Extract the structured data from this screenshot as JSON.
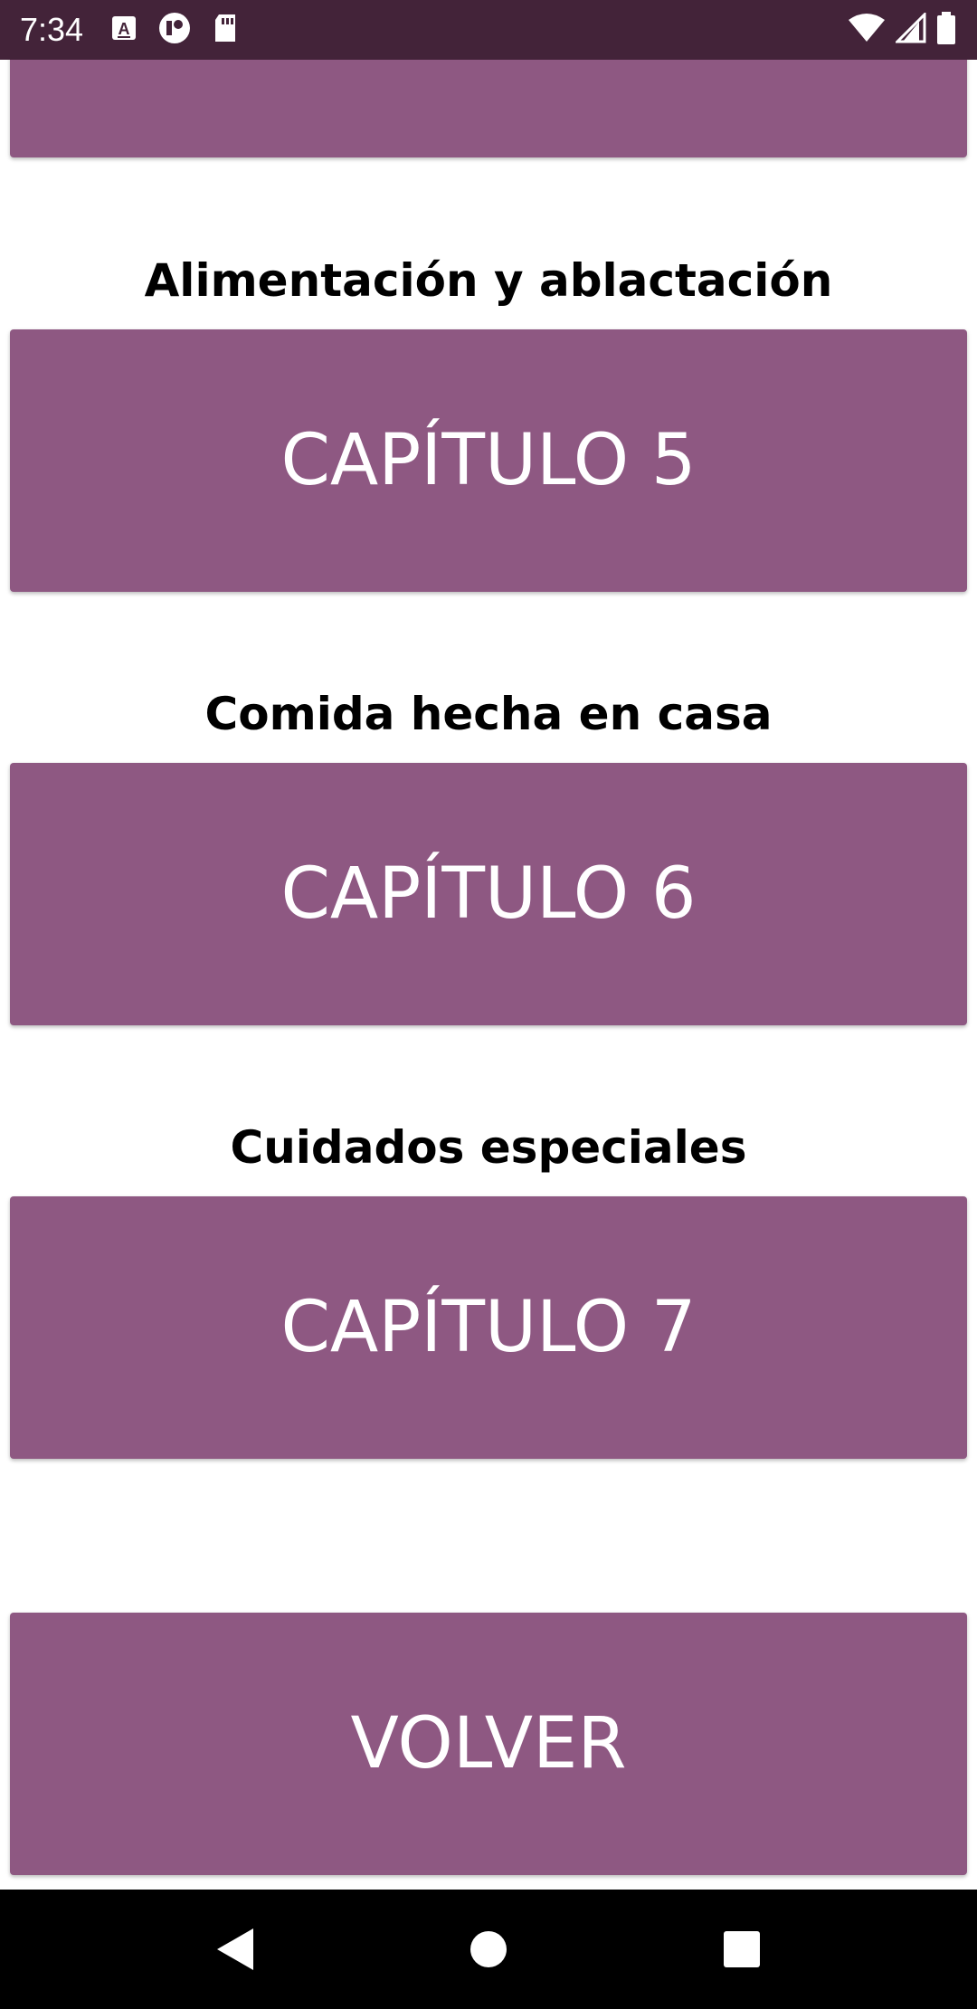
{
  "status_bar": {
    "time": "7:34",
    "left_icons": [
      "a-letter-icon",
      "record-icon",
      "sd-card-icon"
    ],
    "right_icons": [
      "wifi-icon",
      "signal-icon",
      "battery-icon"
    ]
  },
  "sections": [
    {
      "title": "Alimentación y ablactación",
      "button_label": "CAPÍTULO 5"
    },
    {
      "title": "Comida hecha en casa",
      "button_label": "CAPÍTULO 6"
    },
    {
      "title": "Cuidados especiales",
      "button_label": "CAPÍTULO 7"
    }
  ],
  "back_button": {
    "label": "VOLVER"
  },
  "colors": {
    "status_bar": "#432339",
    "button": "#8e5882",
    "button_text": "#ffffff",
    "nav_bar": "#000000"
  },
  "nav_bar": {
    "buttons": [
      "back-triangle-icon",
      "home-circle-icon",
      "recents-square-icon"
    ]
  }
}
